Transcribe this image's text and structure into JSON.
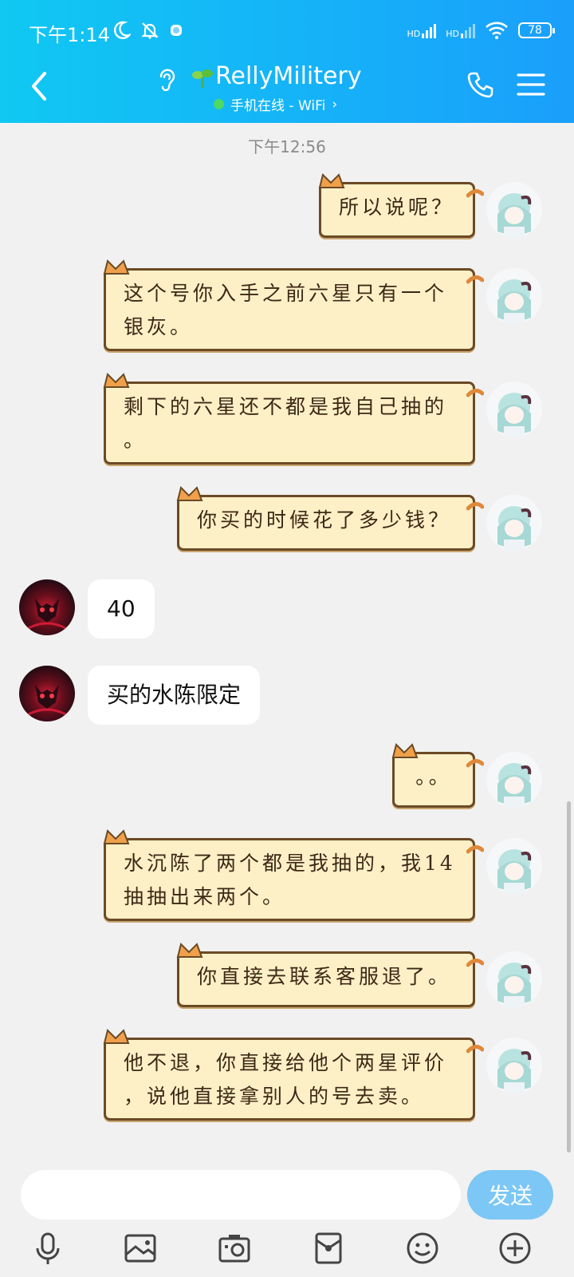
{
  "status_bar": {
    "time": "下午1:14",
    "signal1": "HD",
    "signal2": "HD",
    "battery": "78"
  },
  "header": {
    "contact_name": "RellyMilitery",
    "online_status": "手机在线 - WiFi",
    "online_chevron": "›"
  },
  "chat": {
    "timestamp": "下午12:56",
    "messages": [
      {
        "side": "out",
        "lines": [
          "所以说呢？"
        ]
      },
      {
        "side": "out",
        "lines": [
          "这个号你入手之前六星只有一个",
          "银灰。"
        ]
      },
      {
        "side": "out",
        "lines": [
          "剩下的六星还不都是我自己抽的",
          "。"
        ]
      },
      {
        "side": "out",
        "lines": [
          "你买的时候花了多少钱？"
        ]
      },
      {
        "side": "in",
        "lines": [
          "40"
        ]
      },
      {
        "side": "in",
        "lines": [
          "买的水陈限定"
        ]
      },
      {
        "side": "out",
        "lines": [
          "。。"
        ]
      },
      {
        "side": "out",
        "lines": [
          "水沉陈了两个都是我抽的，我14",
          "抽抽出来两个。"
        ]
      },
      {
        "side": "out",
        "lines": [
          "你直接去联系客服退了。"
        ]
      },
      {
        "side": "out",
        "lines": [
          "他不退，你直接给他个两星评价",
          "，说他直接拿别人的号去卖。"
        ]
      }
    ]
  },
  "composer": {
    "input_value": "",
    "send_label": "发送"
  },
  "toolbar": {
    "icons": [
      "microphone-icon",
      "image-icon",
      "camera-icon",
      "red-packet-icon",
      "emoji-icon",
      "plus-icon"
    ]
  },
  "colors": {
    "header_gradient_start": "#10c8f2",
    "header_gradient_end": "#1a9ffb",
    "bubble_fill": "#fdf0c7",
    "bubble_border": "#6b4a24",
    "send_button": "#7cc7f5",
    "chat_background": "#f1f1f1"
  }
}
